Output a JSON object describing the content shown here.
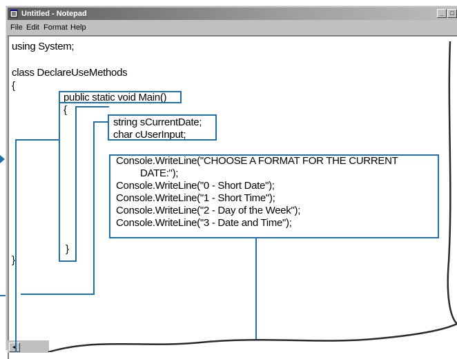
{
  "window": {
    "title": "Untitled - Notepad",
    "controls": {
      "minimize": "_",
      "maximize": "□"
    }
  },
  "menu": [
    "File",
    "Edit",
    "Format",
    "Help"
  ],
  "code": [
    "using System;",
    "",
    "class DeclareUseMethods",
    "{",
    "public static void Main()",
    "{",
    "string sCurrentDate;",
    "char cUserInput;",
    "Console.WriteLine(\"CHOOSE A FORMAT FOR THE CURRENT",
    "DATE:\");",
    "Console.WriteLine(\"0 - Short Date\");",
    "Console.WriteLine(\"1 - Short Time\");",
    "Console.WriteLine(\"2 - Day of the Week\");",
    "Console.WriteLine(\"3 - Date and Time\");",
    "}",
    "}"
  ],
  "colors": {
    "callout": "#1f6fa8",
    "titlebar": "#5a5a5a",
    "chrome": "#c0c0c0"
  },
  "icons": {
    "app": "notepad-icon",
    "scroll_left": "arrow-left-icon"
  }
}
